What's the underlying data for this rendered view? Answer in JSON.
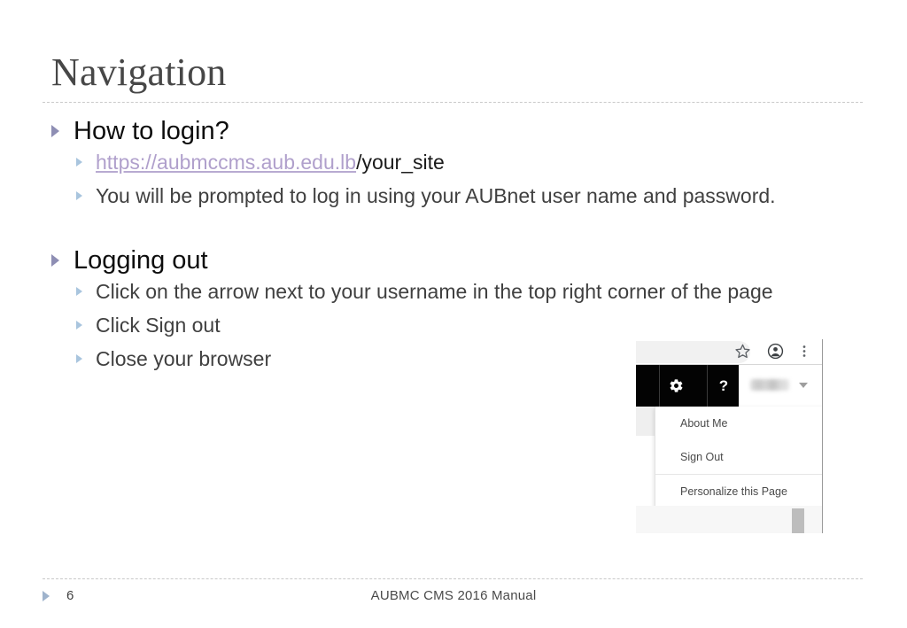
{
  "slide": {
    "title": "Navigation",
    "sections": [
      {
        "heading": "How to login?",
        "items": [
          {
            "link_text": "https://aubmccms.aub.edu.lb",
            "plain_text": "/your_site"
          },
          {
            "text": "You will be prompted to log in using your AUBnet user name and password."
          }
        ]
      },
      {
        "heading": "Logging out",
        "items": [
          {
            "text": "Click on the arrow next to your username in the top right corner of the page"
          },
          {
            "text": "Click Sign out"
          },
          {
            "text": "Close your browser"
          }
        ]
      }
    ]
  },
  "screenshot": {
    "toolbar": {
      "bookmark_icon": "star-icon",
      "profile_icon": "avatar-icon",
      "menu_icon": "kebab-menu-icon"
    },
    "appbar": {
      "settings_icon": "gear-icon",
      "help_label": "?"
    },
    "user": {
      "name_redacted": "",
      "caret_icon": "chevron-down-icon"
    },
    "dropdown": {
      "items": [
        "About Me",
        "Sign Out",
        "Personalize this Page"
      ]
    }
  },
  "footer": {
    "page_number": "6",
    "text": "AUBMC CMS 2016 Manual"
  },
  "colors": {
    "bullet_level1": "#8e8eb4",
    "bullet_level2": "#a9c5de",
    "link": "#b0a0cc",
    "title": "#474747",
    "footer_triangle": "#9fb3cc"
  }
}
